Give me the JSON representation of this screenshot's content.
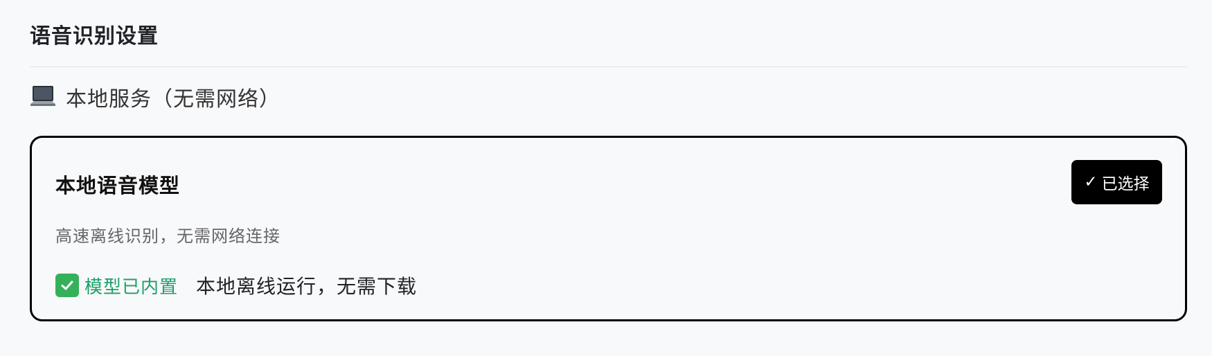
{
  "page": {
    "title": "语音识别设置"
  },
  "section": {
    "icon": "laptop-icon",
    "label": "本地服务（无需网络）"
  },
  "card": {
    "title": "本地语音模型",
    "description": "高速离线识别，无需网络连接",
    "button_label": "已选择",
    "button_check": "✓",
    "status_icon": "check-box-icon",
    "status_text": "模型已内置",
    "status_note": "本地离线运行，无需下载"
  },
  "colors": {
    "background": "#f8f9fb",
    "card_border": "#000000",
    "button_bg": "#000000",
    "button_text": "#ffffff",
    "status_green": "#1e9f6a",
    "check_green": "#36b15b"
  }
}
